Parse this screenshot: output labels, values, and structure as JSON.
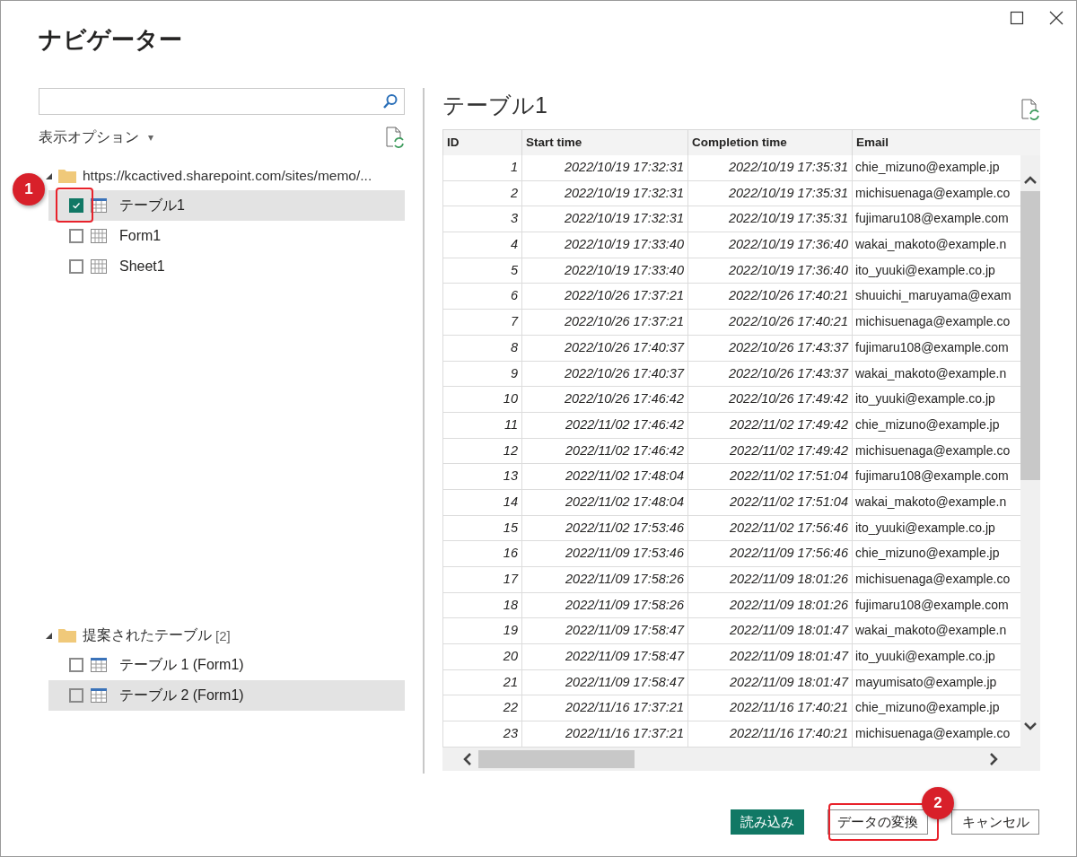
{
  "window": {
    "title": "ナビゲーター"
  },
  "display_options": {
    "label": "表示オプション",
    "caret": "▾"
  },
  "tree": [
    {
      "label": "https://kcactived.sharepoint.com/sites/memo/...",
      "expanded": true,
      "children": [
        {
          "label": "テーブル1",
          "checked": true,
          "selected": true,
          "kind": "table"
        },
        {
          "label": "Form1",
          "checked": false,
          "selected": false,
          "kind": "sheet"
        },
        {
          "label": "Sheet1",
          "checked": false,
          "selected": false,
          "kind": "sheet"
        }
      ]
    },
    {
      "label": "提案されたテーブル",
      "expanded": true,
      "count": "[2]",
      "children": [
        {
          "label": "テーブル 1 (Form1)",
          "checked": false,
          "selected": false,
          "kind": "table"
        },
        {
          "label": "テーブル 2 (Form1)",
          "checked": false,
          "selected": true,
          "kind": "table"
        }
      ]
    }
  ],
  "preview": {
    "title": "テーブル1",
    "columns": [
      "ID",
      "Start time",
      "Completion time",
      "Email"
    ],
    "rows": [
      [
        "1",
        "2022/10/19 17:32:31",
        "2022/10/19 17:35:31",
        "chie_mizuno@example.jp"
      ],
      [
        "2",
        "2022/10/19 17:32:31",
        "2022/10/19 17:35:31",
        "michisuenaga@example.co"
      ],
      [
        "3",
        "2022/10/19 17:32:31",
        "2022/10/19 17:35:31",
        "fujimaru108@example.com"
      ],
      [
        "4",
        "2022/10/19 17:33:40",
        "2022/10/19 17:36:40",
        "wakai_makoto@example.n"
      ],
      [
        "5",
        "2022/10/19 17:33:40",
        "2022/10/19 17:36:40",
        "ito_yuuki@example.co.jp"
      ],
      [
        "6",
        "2022/10/26 17:37:21",
        "2022/10/26 17:40:21",
        "shuuichi_maruyama@exam"
      ],
      [
        "7",
        "2022/10/26 17:37:21",
        "2022/10/26 17:40:21",
        "michisuenaga@example.co"
      ],
      [
        "8",
        "2022/10/26 17:40:37",
        "2022/10/26 17:43:37",
        "fujimaru108@example.com"
      ],
      [
        "9",
        "2022/10/26 17:40:37",
        "2022/10/26 17:43:37",
        "wakai_makoto@example.n"
      ],
      [
        "10",
        "2022/10/26 17:46:42",
        "2022/10/26 17:49:42",
        "ito_yuuki@example.co.jp"
      ],
      [
        "11",
        "2022/11/02 17:46:42",
        "2022/11/02 17:49:42",
        "chie_mizuno@example.jp"
      ],
      [
        "12",
        "2022/11/02 17:46:42",
        "2022/11/02 17:49:42",
        "michisuenaga@example.co"
      ],
      [
        "13",
        "2022/11/02 17:48:04",
        "2022/11/02 17:51:04",
        "fujimaru108@example.com"
      ],
      [
        "14",
        "2022/11/02 17:48:04",
        "2022/11/02 17:51:04",
        "wakai_makoto@example.n"
      ],
      [
        "15",
        "2022/11/02 17:53:46",
        "2022/11/02 17:56:46",
        "ito_yuuki@example.co.jp"
      ],
      [
        "16",
        "2022/11/09 17:53:46",
        "2022/11/09 17:56:46",
        "chie_mizuno@example.jp"
      ],
      [
        "17",
        "2022/11/09 17:58:26",
        "2022/11/09 18:01:26",
        "michisuenaga@example.co"
      ],
      [
        "18",
        "2022/11/09 17:58:26",
        "2022/11/09 18:01:26",
        "fujimaru108@example.com"
      ],
      [
        "19",
        "2022/11/09 17:58:47",
        "2022/11/09 18:01:47",
        "wakai_makoto@example.n"
      ],
      [
        "20",
        "2022/11/09 17:58:47",
        "2022/11/09 18:01:47",
        "ito_yuuki@example.co.jp"
      ],
      [
        "21",
        "2022/11/09 17:58:47",
        "2022/11/09 18:01:47",
        "mayumisato@example.jp"
      ],
      [
        "22",
        "2022/11/16 17:37:21",
        "2022/11/16 17:40:21",
        "chie_mizuno@example.jp"
      ],
      [
        "23",
        "2022/11/16 17:37:21",
        "2022/11/16 17:40:21",
        "michisuenaga@example.co"
      ]
    ]
  },
  "buttons": [
    {
      "label": "読み込み",
      "kind": "primary"
    },
    {
      "label": "データの変換",
      "kind": "secondary"
    },
    {
      "label": "キャンセル",
      "kind": "secondary"
    }
  ],
  "annotations": [
    {
      "number": "1"
    },
    {
      "number": "2"
    }
  ]
}
